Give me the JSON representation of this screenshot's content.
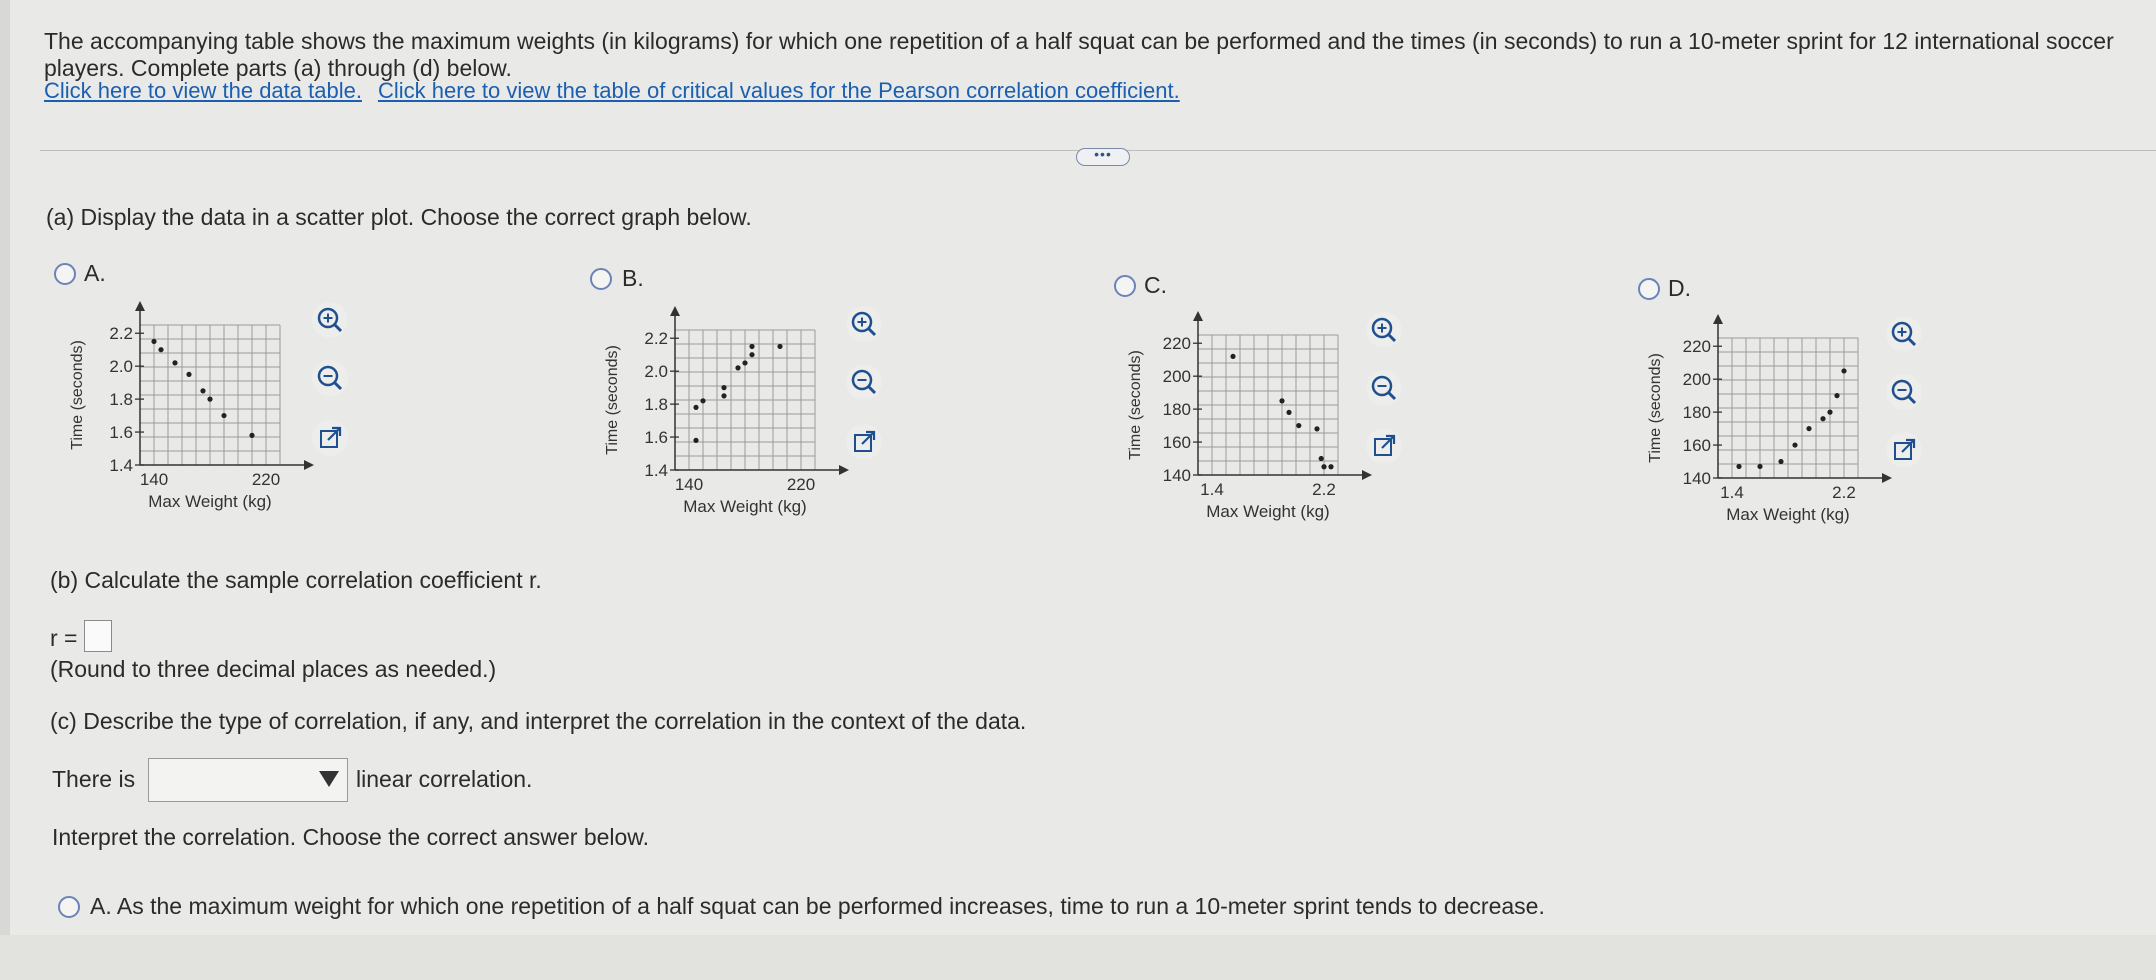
{
  "question": {
    "text": "The accompanying table shows the maximum weights (in kilograms) for which one repetition of a half squat can be performed and the times (in seconds) to run a 10-meter sprint for 12 international soccer players. Complete parts (a) through (d) below.",
    "link_table": "Click here to view the data table.",
    "link_critical": "Click here to view the table of critical values for the Pearson correlation coefficient."
  },
  "ellipsis": "•••",
  "part_a": {
    "prompt": "(a) Display the data in a scatter plot. Choose the correct graph below.",
    "options": [
      {
        "label": "A.",
        "chart_data": {
          "type": "scatter",
          "xlabel": "Max Weight (kg)",
          "ylabel": "Time (seconds)",
          "xlim": [
            130,
            230
          ],
          "ylim": [
            1.4,
            2.25
          ],
          "xticks": [
            "140",
            "220"
          ],
          "yticks": [
            "1.4",
            "1.6",
            "1.8",
            "2.0",
            "2.2"
          ],
          "grid": true,
          "points": [
            [
              140,
              2.15
            ],
            [
              145,
              2.1
            ],
            [
              155,
              2.02
            ],
            [
              165,
              1.95
            ],
            [
              175,
              1.85
            ],
            [
              180,
              1.8
            ],
            [
              190,
              1.7
            ],
            [
              210,
              1.58
            ]
          ]
        }
      },
      {
        "label": "B.",
        "chart_data": {
          "type": "scatter",
          "xlabel": "Max Weight (kg)",
          "ylabel": "Time (seconds)",
          "xlim": [
            130,
            230
          ],
          "ylim": [
            1.4,
            2.25
          ],
          "xticks": [
            "140",
            "220"
          ],
          "yticks": [
            "1.4",
            "1.6",
            "1.8",
            "2.0",
            "2.2"
          ],
          "grid": true,
          "points": [
            [
              145,
              1.58
            ],
            [
              145,
              1.78
            ],
            [
              150,
              1.82
            ],
            [
              165,
              1.85
            ],
            [
              165,
              1.9
            ],
            [
              175,
              2.02
            ],
            [
              180,
              2.05
            ],
            [
              185,
              2.1
            ],
            [
              185,
              2.15
            ],
            [
              205,
              2.15
            ]
          ]
        }
      },
      {
        "label": "C.",
        "chart_data": {
          "type": "scatter",
          "xlabel": "Max Weight (kg)",
          "ylabel": "Time (seconds)",
          "xlim": [
            1.3,
            2.3
          ],
          "ylim": [
            140,
            225
          ],
          "xticks": [
            "1.4",
            "2.2"
          ],
          "yticks": [
            "140",
            "160",
            "180",
            "200",
            "220"
          ],
          "grid": true,
          "points": [
            [
              1.55,
              212
            ],
            [
              1.9,
              185
            ],
            [
              1.95,
              178
            ],
            [
              2.02,
              170
            ],
            [
              2.15,
              168
            ],
            [
              2.18,
              150
            ],
            [
              2.2,
              145
            ],
            [
              2.25,
              145
            ]
          ]
        }
      },
      {
        "label": "D.",
        "chart_data": {
          "type": "scatter",
          "xlabel": "Max Weight (kg)",
          "ylabel": "Time (seconds)",
          "xlim": [
            1.3,
            2.3
          ],
          "ylim": [
            140,
            225
          ],
          "xticks": [
            "1.4",
            "2.2"
          ],
          "yticks": [
            "140",
            "160",
            "180",
            "200",
            "220"
          ],
          "grid": true,
          "points": [
            [
              1.45,
              147
            ],
            [
              1.6,
              147
            ],
            [
              1.75,
              150
            ],
            [
              1.85,
              160
            ],
            [
              1.95,
              170
            ],
            [
              2.05,
              176
            ],
            [
              2.1,
              180
            ],
            [
              2.15,
              190
            ],
            [
              2.2,
              205
            ]
          ]
        }
      }
    ]
  },
  "part_b": {
    "prompt": "(b) Calculate the sample correlation coefficient r.",
    "r_label": "r =",
    "r_value": "",
    "note": "(Round to three decimal places as needed.)"
  },
  "part_c": {
    "prompt": "(c) Describe the type of correlation, if any, and interpret the correlation in the context of the data.",
    "there_is": "There is",
    "dropdown_value": "",
    "linear_correlation": "linear correlation.",
    "interpret": "Interpret the correlation. Choose the correct answer below.",
    "option_a": "A.  As the maximum weight for which one repetition of a half squat can be performed increases, time to run a 10-meter sprint tends to decrease."
  },
  "colors": {
    "link": "#1b5fb0",
    "radio": "#6a84b8",
    "background": "#e9e9e7"
  }
}
